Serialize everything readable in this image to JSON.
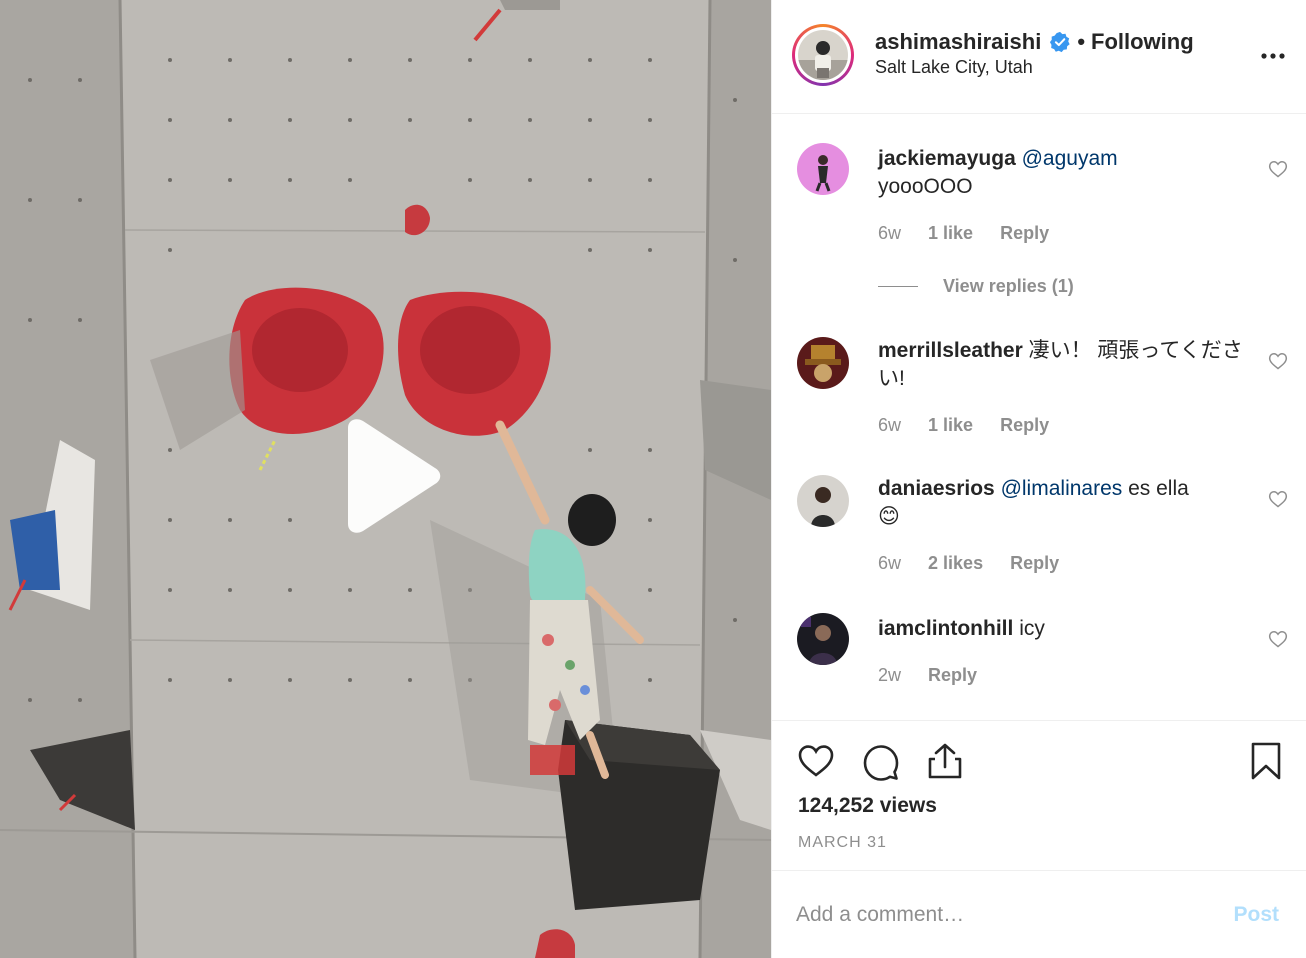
{
  "post": {
    "owner": {
      "username": "ashimashiraishi",
      "verified": true,
      "follow_state": "Following",
      "separator": "•",
      "location": "Salt Lake City, Utah"
    },
    "media": {
      "type": "video",
      "icon": "play-icon"
    },
    "comments": [
      {
        "username": "jackiemayuga",
        "mention": "@aguyam",
        "text": "yoooOOO",
        "time": "6w",
        "likes": "1 like",
        "reply": "Reply",
        "view_replies": "View replies (1)"
      },
      {
        "username": "merrillsleather",
        "mention": "",
        "text": "凄い！ 頑張ってください!",
        "time": "6w",
        "likes": "1 like",
        "reply": "Reply"
      },
      {
        "username": "daniaesrios",
        "mention": "@limalinares",
        "text": "es ella",
        "emoji": "😊",
        "time": "6w",
        "likes": "2 likes",
        "reply": "Reply"
      },
      {
        "username": "iamclintonhill",
        "mention": "",
        "text": "icy",
        "time": "2w",
        "reply": "Reply"
      }
    ],
    "actions": {
      "like": "heart-icon",
      "comment": "comment-icon",
      "share": "share-icon",
      "save": "bookmark-icon"
    },
    "views": "124,252 views",
    "date": "MARCH 31",
    "add_comment": {
      "placeholder": "Add a comment…",
      "post_label": "Post"
    }
  },
  "colors": {
    "accent_link": "#00376b",
    "muted": "#8e8e8e",
    "post_disabled": "#b2dffc",
    "verified": "#3897f0",
    "hold_red": "#d23a3a"
  }
}
